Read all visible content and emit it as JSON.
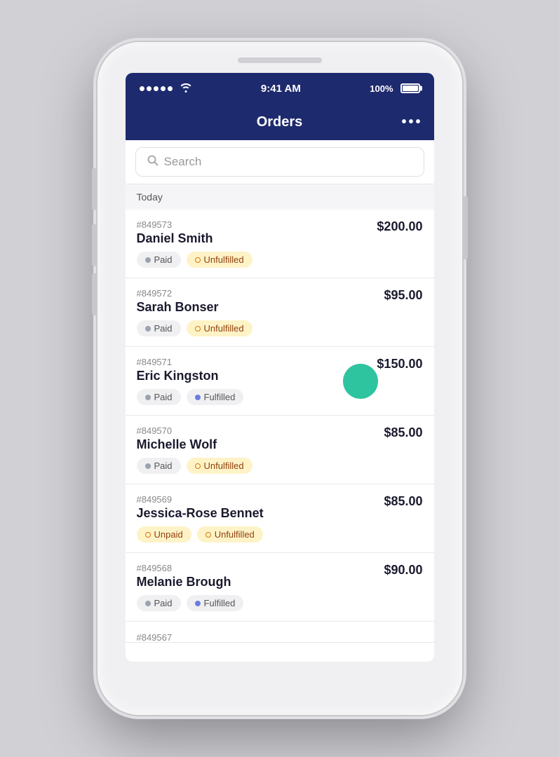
{
  "phone": {
    "status_bar": {
      "time": "9:41 AM",
      "battery_percent": "100%"
    },
    "header": {
      "title": "Orders",
      "menu_label": "•••"
    },
    "search": {
      "placeholder": "Search"
    },
    "section": {
      "label": "Today"
    },
    "orders": [
      {
        "id": "#849573",
        "name": "Daniel Smith",
        "price": "$200.00",
        "tags": [
          {
            "label": "Paid",
            "type": "paid"
          },
          {
            "label": "Unfulfilled",
            "type": "unfulfilled"
          }
        ],
        "has_floating_dot": false
      },
      {
        "id": "#849572",
        "name": "Sarah Bonser",
        "price": "$95.00",
        "tags": [
          {
            "label": "Paid",
            "type": "paid"
          },
          {
            "label": "Unfulfilled",
            "type": "unfulfilled"
          }
        ],
        "has_floating_dot": false
      },
      {
        "id": "#849571",
        "name": "Eric Kingston",
        "price": "$150.00",
        "tags": [
          {
            "label": "Paid",
            "type": "paid"
          },
          {
            "label": "Fulfilled",
            "type": "fulfilled"
          }
        ],
        "has_floating_dot": true
      },
      {
        "id": "#849570",
        "name": "Michelle Wolf",
        "price": "$85.00",
        "tags": [
          {
            "label": "Paid",
            "type": "paid"
          },
          {
            "label": "Unfulfilled",
            "type": "unfulfilled"
          }
        ],
        "has_floating_dot": false
      },
      {
        "id": "#849569",
        "name": "Jessica-Rose Bennet",
        "price": "$85.00",
        "tags": [
          {
            "label": "Unpaid",
            "type": "unpaid"
          },
          {
            "label": "Unfulfilled",
            "type": "unfulfilled"
          }
        ],
        "has_floating_dot": false
      },
      {
        "id": "#849568",
        "name": "Melanie Brough",
        "price": "$90.00",
        "tags": [
          {
            "label": "Paid",
            "type": "paid"
          },
          {
            "label": "Fulfilled",
            "type": "fulfilled"
          }
        ],
        "has_floating_dot": false
      },
      {
        "id": "#849567",
        "name": "",
        "price": "",
        "tags": [],
        "has_floating_dot": false,
        "partial": true
      }
    ]
  }
}
